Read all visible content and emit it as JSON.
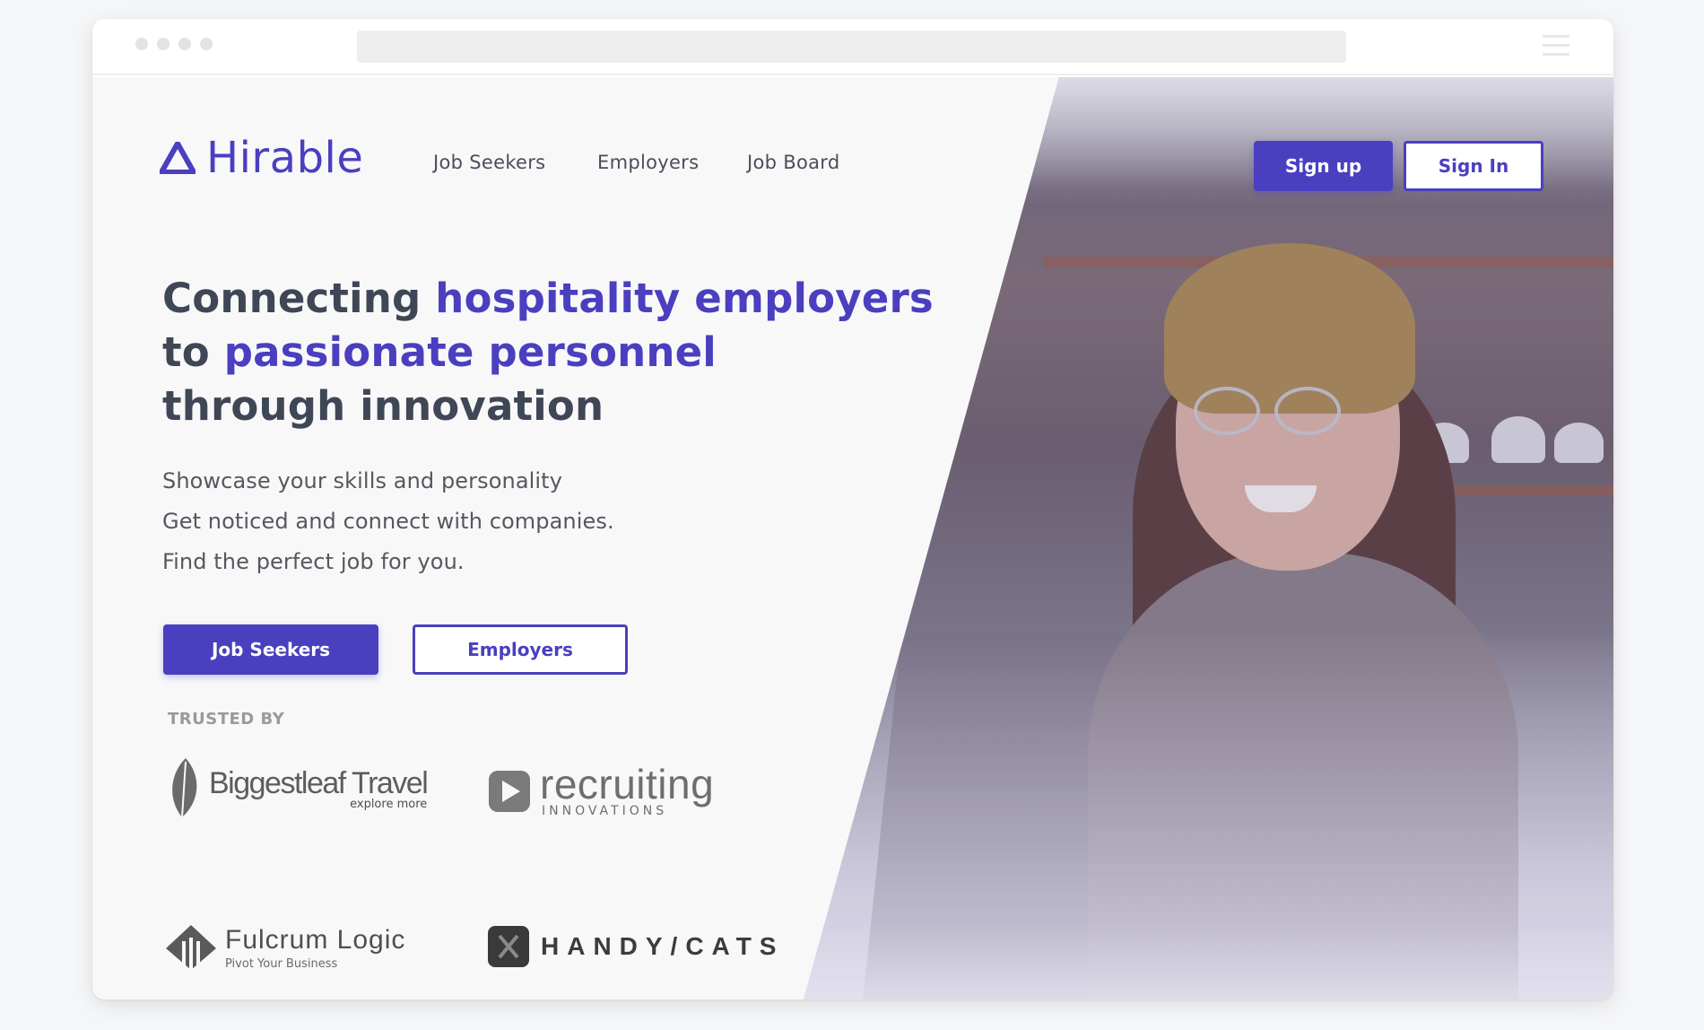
{
  "nav": {
    "logo_text": "Hirable",
    "links": [
      "Job Seekers",
      "Employers",
      "Job Board"
    ],
    "signup_label": "Sign up",
    "signin_label": "Sign In"
  },
  "hero": {
    "headline": {
      "line1_plain": "Connecting ",
      "line1_accent": "hospitality employers",
      "line2_plain": "to ",
      "line2_accent": "passionate personnel",
      "line3_plain": "through innovation"
    },
    "sublines": [
      "Showcase your skills and personality",
      "Get noticed and connect with companies.",
      "Find the perfect job for you."
    ],
    "cta_primary": "Job Seekers",
    "cta_secondary": "Employers"
  },
  "trusted": {
    "heading": "TRUSTED BY",
    "logos": [
      {
        "name": "Biggestleaf Travel",
        "tagline": "explore more",
        "icon": "leaf-icon"
      },
      {
        "name": "recruiting",
        "tagline": "INNOVATIONS",
        "icon": "play-icon"
      },
      {
        "name": "Fulcrum Logic",
        "tagline": "Pivot Your Business",
        "icon": "pillar-icon"
      },
      {
        "name": "HANDY/CATS",
        "tagline": "",
        "icon": "handycats-icon"
      }
    ]
  },
  "colors": {
    "brand": "#4a3fbf",
    "heading": "#3f4756",
    "body": "#55585f"
  }
}
